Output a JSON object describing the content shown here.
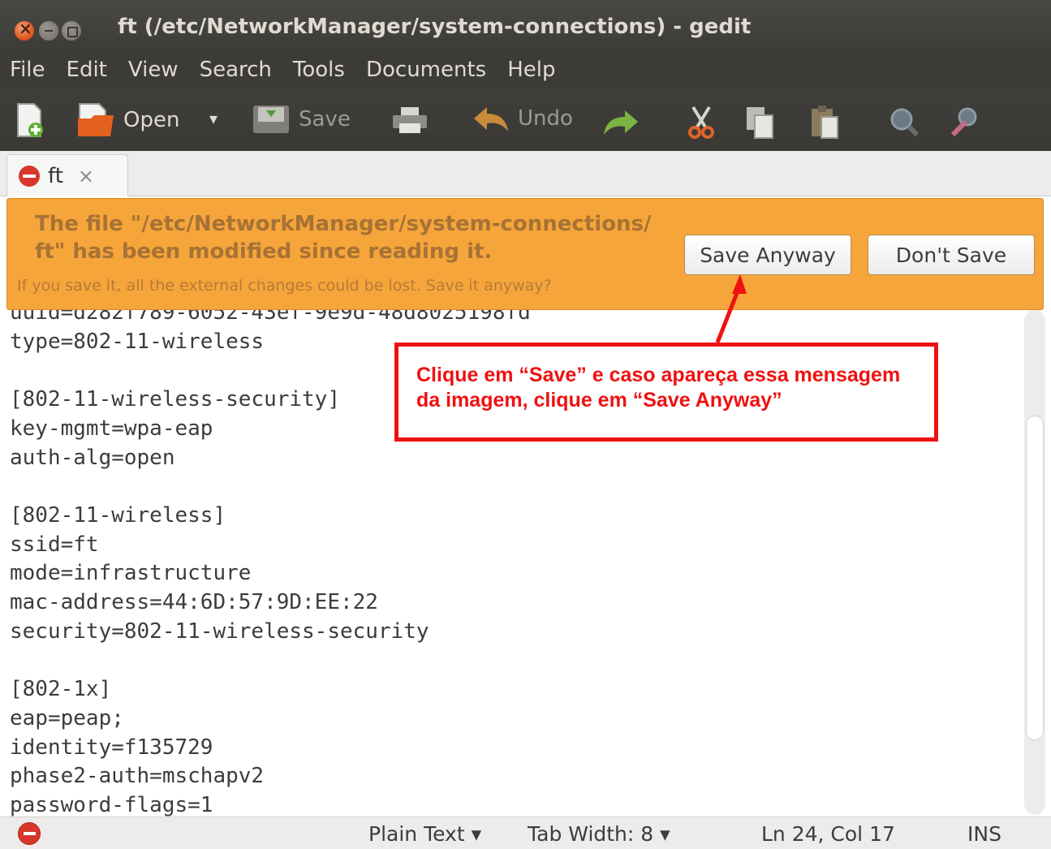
{
  "window": {
    "title": "ft (/etc/NetworkManager/system-connections) - gedit"
  },
  "menubar": {
    "items": [
      "File",
      "Edit",
      "View",
      "Search",
      "Tools",
      "Documents",
      "Help"
    ]
  },
  "toolbar": {
    "open_label": "Open",
    "open_dropdown": "▾",
    "save_label": "Save",
    "undo_label": "Undo"
  },
  "tab": {
    "label": "ft",
    "close": "×"
  },
  "infobar": {
    "primary": "The file \"/etc/NetworkManager/system-connections/ ft\" has been modified since reading it.",
    "secondary": "If you save it, all the external changes could be lost. Save it anyway?",
    "save_anyway": "Save Anyway",
    "dont_save": "Don't Save"
  },
  "editor": {
    "lines": [
      "uuid=d282f789-6052-43ef-9e9d-48d8025198fd",
      "type=802-11-wireless",
      "",
      "[802-11-wireless-security]",
      "key-mgmt=wpa-eap",
      "auth-alg=open",
      "",
      "[802-11-wireless]",
      "ssid=ft",
      "mode=infrastructure",
      "mac-address=44:6D:57:9D:EE:22",
      "security=802-11-wireless-security",
      "",
      "[802-1x]",
      "eap=peap;",
      "identity=f135729",
      "phase2-auth=mschapv2",
      "password-flags=1"
    ]
  },
  "statusbar": {
    "language": "Plain Text ▾",
    "tab_width": "Tab Width: 8 ▾",
    "position": "Ln 24, Col 17",
    "mode": "INS"
  },
  "annotation": {
    "text": "Clique em “Save” e caso apareça essa mensagem da imagem, clique em “Save Anyway”"
  },
  "colors": {
    "annotation": "#ee1111",
    "infobar": "#f6a53a",
    "titlebar": "#3c3b37"
  }
}
